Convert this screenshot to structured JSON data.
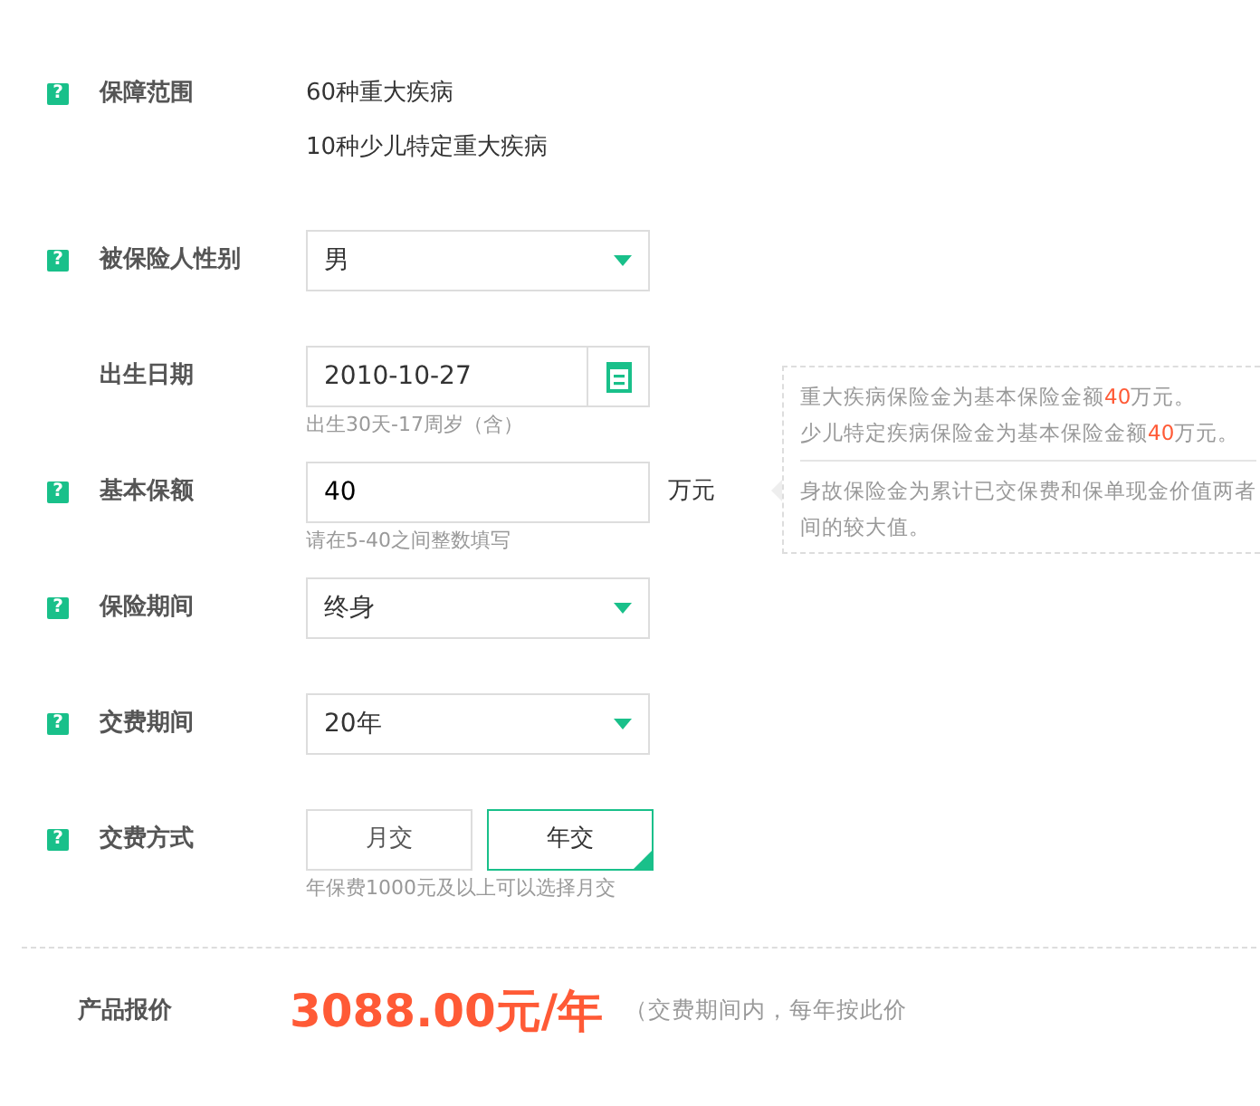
{
  "fields": [
    {
      "kind": "coverage",
      "help": "?",
      "label": "保障范围",
      "lines": [
        "60种重大疾病",
        "10种少儿特定重大疾病"
      ]
    },
    {
      "kind": "select",
      "help": "?",
      "label": "被保险人性别",
      "value": "男"
    },
    {
      "kind": "date",
      "label": "出生日期",
      "value": "2010-10-27",
      "hint": "出生30天-17周岁（含）"
    },
    {
      "kind": "amount",
      "help": "?",
      "label": "基本保额",
      "value": "40",
      "unit": "万元",
      "hint": "请在5-40之间整数填写"
    },
    {
      "kind": "select",
      "help": "?",
      "label": "保险期间",
      "value": "终身"
    },
    {
      "kind": "select",
      "help": "?",
      "label": "交费期间",
      "value": "20年"
    },
    {
      "kind": "toggle",
      "help": "?",
      "label": "交费方式",
      "options": [
        {
          "label": "月交",
          "selected": false
        },
        {
          "label": "年交",
          "selected": true
        }
      ],
      "hint": "年保费1000元及以上可以选择月交"
    }
  ],
  "tooltip": {
    "lines": [
      "重大疾病保险金为基本保险金额**40**万元。",
      "少儿特定疾病保险金为基本保险金额**40**万元。"
    ],
    "note": [
      "身故保险金为累计已交保费和保单现金价值两者",
      "间的较大值。"
    ]
  },
  "price": {
    "label": "产品报价",
    "amount": "3088.00元/年",
    "note": "（交费期间内，每年按此价"
  }
}
